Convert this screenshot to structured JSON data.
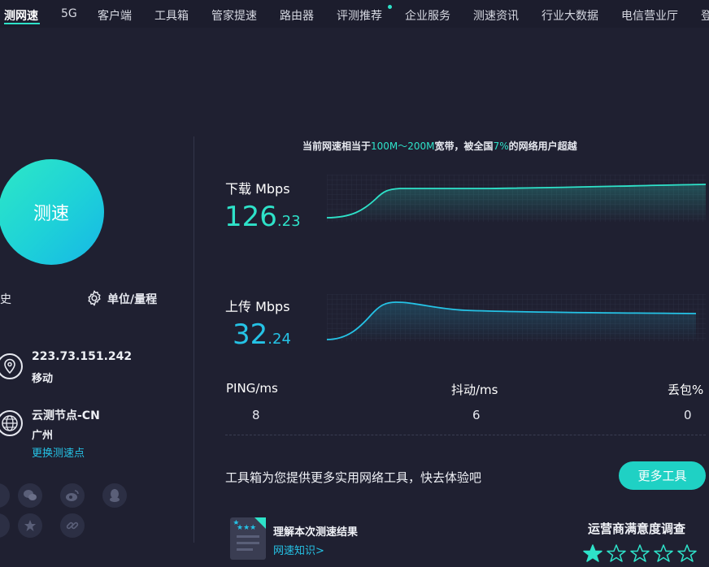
{
  "nav": {
    "items": [
      "测网速",
      "5G",
      "客户端",
      "工具箱",
      "管家提速",
      "路由器",
      "评测推荐",
      "企业服务",
      "测速资讯",
      "行业大数据",
      "电信营业厅",
      "登"
    ]
  },
  "left": {
    "speed_button": "测速",
    "history_label": "历史",
    "units_label": "单位/量程",
    "ip": "223.73.151.242",
    "isp": "移动",
    "node_name": "云测节点-CN",
    "node_city": "广州",
    "change_node": "更换测速点"
  },
  "summary": {
    "prefix": "当前网速相当于",
    "bandwidth": "100M～200M",
    "middle": "宽带，被全国",
    "percent": "7%",
    "suffix": "的网络用户超越"
  },
  "download": {
    "label": "下载 Mbps",
    "int": "126",
    "dec": ".23",
    "color": "#2ee2c9"
  },
  "upload": {
    "label": "上传 Mbps",
    "int": "32",
    "dec": ".24",
    "color": "#25c3e6"
  },
  "stats": {
    "ping_label": "PING/ms",
    "ping_value": "8",
    "jitter_label": "抖动/ms",
    "jitter_value": "6",
    "loss_label": "丢包%",
    "loss_value": "0"
  },
  "tools": {
    "text": "工具箱为您提供更多实用网络工具，快去体验吧",
    "button": "更多工具"
  },
  "card": {
    "title": "理解本次测速结果",
    "link": "网速知识>"
  },
  "survey": {
    "title": "运营商满意度调查",
    "rating": 1,
    "max": 5
  },
  "colors": {
    "accent": "#2ee2c9",
    "link": "#25c3e6",
    "bg": "#1f2031"
  }
}
